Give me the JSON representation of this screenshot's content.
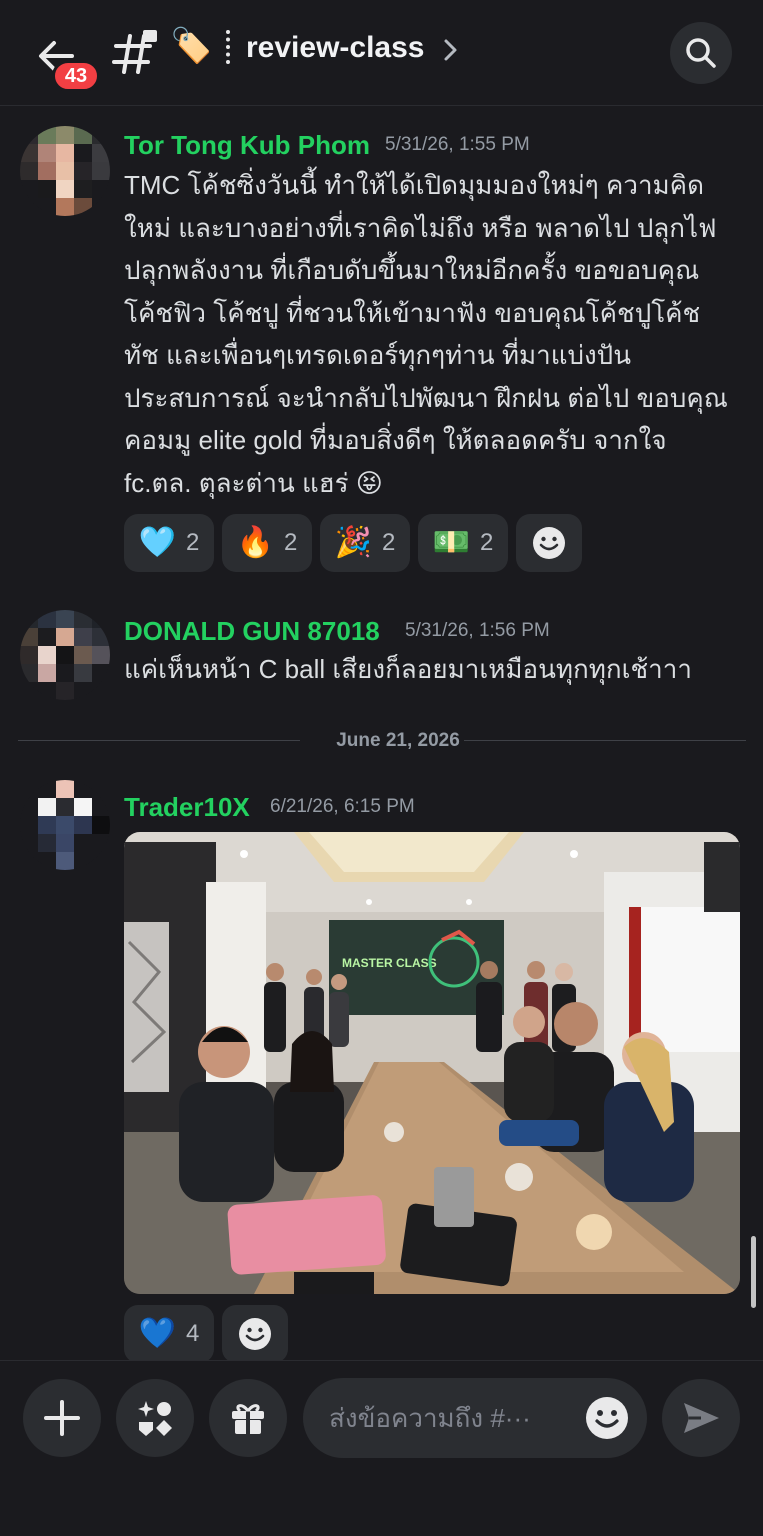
{
  "header": {
    "unread_count": "43",
    "channel_emoji": "🏷️",
    "channel_name": "review-class"
  },
  "messages": [
    {
      "username": "Tor Tong Kub Phom",
      "timestamp": "5/31/26, 1:55 PM",
      "text": "TMC  โค้ชซิ่งวันนี้ ทำให้ได้เปิดมุมมองใหม่ๆ ความคิดใหม่ และบางอย่างที่เราคิดไม่ถึง หรือ พลาดไป ปลุกไฟปลุกพลังงาน ที่เกือบดับขึ้นมาใหม่อีกครั้ง ขอขอบคุณ โค้ชฟิว โค้ชปู ที่ชวนให้เข้ามาฟัง ขอบคุณโค้ชปูโค้ชทัช และเพื่อนๆเทรดเดอร์ทุกๆท่าน ที่มาแบ่งปันประสบการณ์  จะนำกลับไปพัฒนา ฝึกฝน ต่อไป ขอบคุณคอมมู elite gold ที่มอบสิ่งดีๆ ให้ตลอดครับ จากใจ fc.ตล. ตุละต่าน แฮร่ 😝",
      "reactions": [
        {
          "emoji": "🩵",
          "count": "2"
        },
        {
          "emoji": "🔥",
          "count": "2"
        },
        {
          "emoji": "🎉",
          "count": "2"
        },
        {
          "emoji": "💵",
          "count": "2"
        }
      ]
    },
    {
      "username": "DONALD GUN 87018",
      "timestamp": "5/31/26, 1:56 PM",
      "text": "แค่เห็นหน้า C ball เสียงก็ลอยมาเหมือนทุกทุกเช้าาา"
    },
    {
      "username": "Trader10X",
      "timestamp": "6/21/26, 6:15 PM",
      "image_screen_text": "MASTER CLASS",
      "reactions": [
        {
          "emoji": "💙",
          "count": "4"
        }
      ]
    }
  ],
  "date_divider": "June 21, 2026",
  "composer": {
    "placeholder": "ส่งข้อความถึง #···"
  },
  "colors": {
    "background": "#1a1a1e",
    "username": "#23d160",
    "badge": "#f23f43",
    "surface": "#2b2d31"
  },
  "icons": [
    "back-arrow-icon",
    "hashtag-icon",
    "tag-icon",
    "chevron-right-icon",
    "search-icon",
    "smile-add-icon",
    "plus-icon",
    "apps-icon",
    "gift-icon",
    "emoji-icon",
    "send-icon"
  ]
}
